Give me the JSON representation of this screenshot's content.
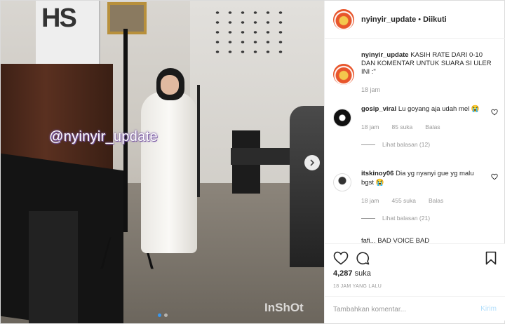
{
  "post": {
    "media": {
      "watermark": "@nyinyir_update",
      "app_watermark": "InShOt",
      "banner_text": "HS",
      "carousel_total": 2,
      "carousel_active": 1
    },
    "header": {
      "username": "nyinyir_update",
      "separator": "•",
      "follow_status": "Diikuti"
    },
    "caption": {
      "username": "nyinyir_update",
      "text": "KASIH RATE DARI 0-10 DAN KOMENTAR UNTUK SUARA SI ULER INI :\"",
      "time": "18 jam"
    },
    "comments": [
      {
        "username": "gosip_viral",
        "text": "Lu goyang aja udah mel 😭",
        "time": "18 jam",
        "likes": "85 suka",
        "reply_label": "Balas",
        "view_replies": "Lihat balasan (12)"
      },
      {
        "username": "itskinoy06",
        "text": "Dia yg nyanyi gue yg malu bgst 😭",
        "time": "18 jam",
        "likes": "455 suka",
        "reply_label": "Balas",
        "view_replies": "Lihat balasan (21)"
      }
    ],
    "partial_comment": "fafi... BAD VOICE BAD",
    "likes_count": "4,287",
    "likes_label": "suka",
    "posted_time": "18 JAM YANG LALU",
    "comment_placeholder": "Tambahkan komentar...",
    "post_button": "Kirim"
  },
  "colors": {
    "accent": "#3897f0",
    "post_button_disabled": "#b2dffc",
    "muted_text": "#999999",
    "border": "#efefef"
  }
}
